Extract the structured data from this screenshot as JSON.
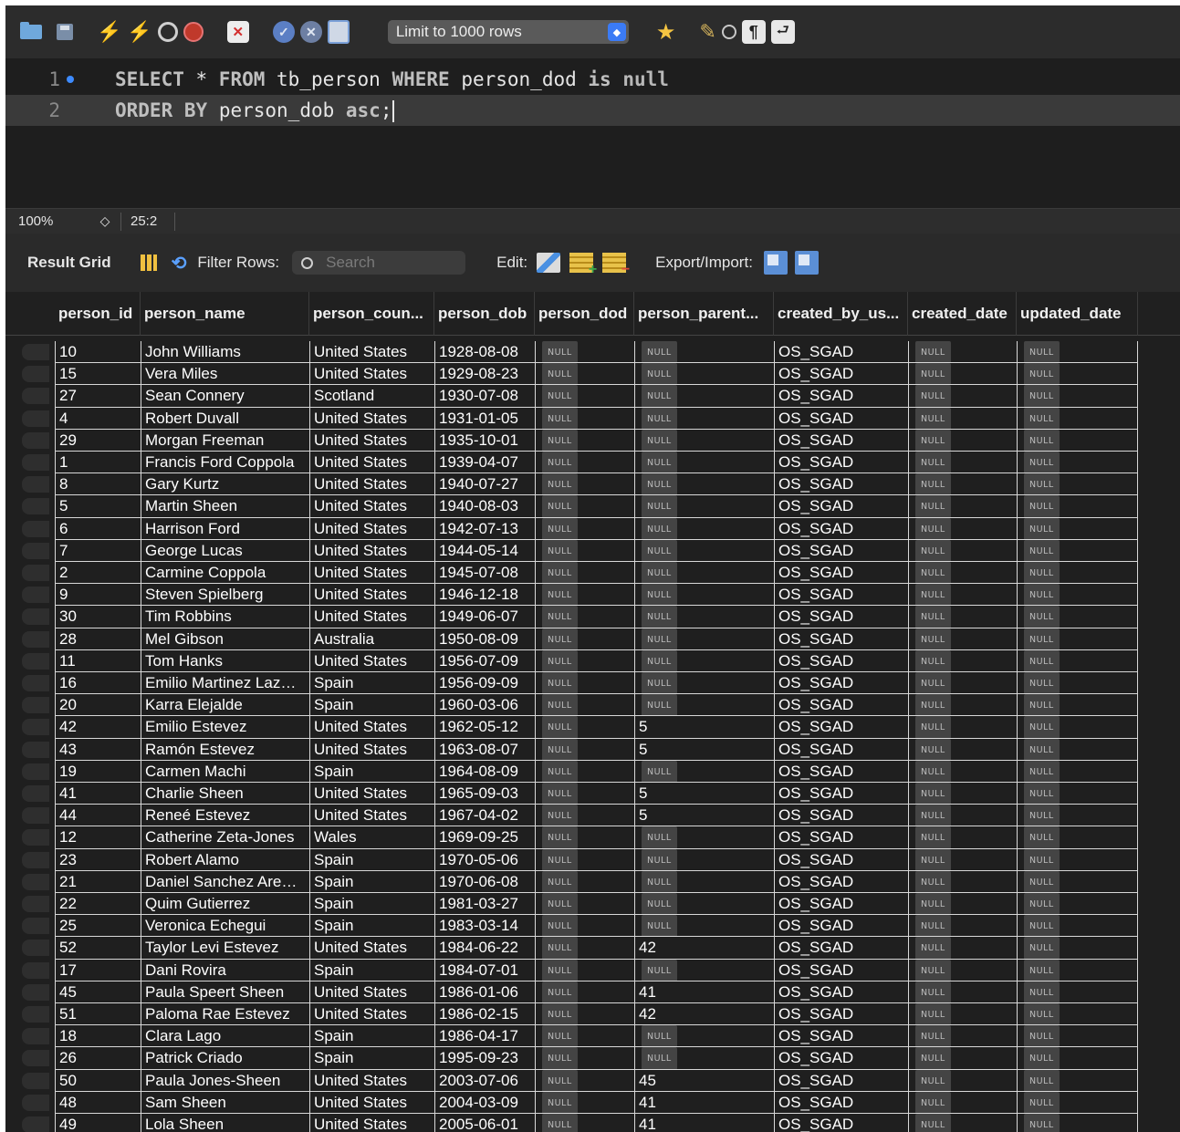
{
  "toolbar": {
    "limit_select_value": "Limit to 1000 rows",
    "icons": [
      "folder-icon",
      "save-icon",
      "execute-icon",
      "execute-current-icon",
      "explain-icon",
      "stop-icon",
      "toggle-error-icon",
      "commit-icon",
      "rollback-icon",
      "autocommit-icon",
      "add-snippet-icon",
      "beautify-icon",
      "find-icon",
      "invisible-chars-icon",
      "wrap-lines-icon"
    ]
  },
  "editor": {
    "lines": [
      {
        "number": "1",
        "tokens": [
          {
            "t": "SELECT",
            "k": "kw"
          },
          {
            "t": " * ",
            "k": "id"
          },
          {
            "t": "FROM",
            "k": "kw"
          },
          {
            "t": " tb_person ",
            "k": "id"
          },
          {
            "t": "WHERE",
            "k": "kw"
          },
          {
            "t": " person_dod ",
            "k": "id"
          },
          {
            "t": "is",
            "k": "kw"
          },
          {
            "t": " ",
            "k": "id"
          },
          {
            "t": "null",
            "k": "kwv"
          }
        ]
      },
      {
        "number": "2",
        "tokens": [
          {
            "t": "ORDER",
            "k": "kw"
          },
          {
            "t": " ",
            "k": "id"
          },
          {
            "t": "BY",
            "k": "kw"
          },
          {
            "t": " person_dob ",
            "k": "id"
          },
          {
            "t": "asc",
            "k": "kw"
          },
          {
            "t": ";",
            "k": "id"
          }
        ]
      }
    ]
  },
  "status": {
    "zoom": "100%",
    "zoom_stepper": "◇",
    "cursor_position": "25:2"
  },
  "result_toolbar": {
    "label": "Result Grid",
    "filter_label": "Filter Rows:",
    "search_placeholder": "Search",
    "edit_label": "Edit:",
    "export_label": "Export/Import:"
  },
  "grid": {
    "null_text": "NULL",
    "columns": [
      "person_id",
      "person_name",
      "person_coun...",
      "person_dob",
      "person_dod",
      "person_parent...",
      "created_by_us...",
      "created_date",
      "updated_date"
    ],
    "rows": [
      [
        "10",
        "John Williams",
        "United States",
        "1928-08-08",
        null,
        null,
        "OS_SGAD",
        null,
        null
      ],
      [
        "15",
        "Vera Miles",
        "United States",
        "1929-08-23",
        null,
        null,
        "OS_SGAD",
        null,
        null
      ],
      [
        "27",
        "Sean Connery",
        "Scotland",
        "1930-07-08",
        null,
        null,
        "OS_SGAD",
        null,
        null
      ],
      [
        "4",
        "Robert Duvall",
        "United States",
        "1931-01-05",
        null,
        null,
        "OS_SGAD",
        null,
        null
      ],
      [
        "29",
        "Morgan Freeman",
        "United States",
        "1935-10-01",
        null,
        null,
        "OS_SGAD",
        null,
        null
      ],
      [
        "1",
        "Francis Ford Coppola",
        "United States",
        "1939-04-07",
        null,
        null,
        "OS_SGAD",
        null,
        null
      ],
      [
        "8",
        "Gary Kurtz",
        "United States",
        "1940-07-27",
        null,
        null,
        "OS_SGAD",
        null,
        null
      ],
      [
        "5",
        "Martin Sheen",
        "United States",
        "1940-08-03",
        null,
        null,
        "OS_SGAD",
        null,
        null
      ],
      [
        "6",
        "Harrison Ford",
        "United States",
        "1942-07-13",
        null,
        null,
        "OS_SGAD",
        null,
        null
      ],
      [
        "7",
        "George Lucas",
        "United States",
        "1944-05-14",
        null,
        null,
        "OS_SGAD",
        null,
        null
      ],
      [
        "2",
        "Carmine Coppola",
        "United States",
        "1945-07-08",
        null,
        null,
        "OS_SGAD",
        null,
        null
      ],
      [
        "9",
        "Steven Spielberg",
        "United States",
        "1946-12-18",
        null,
        null,
        "OS_SGAD",
        null,
        null
      ],
      [
        "30",
        "Tim Robbins",
        "United States",
        "1949-06-07",
        null,
        null,
        "OS_SGAD",
        null,
        null
      ],
      [
        "28",
        "Mel Gibson",
        "Australia",
        "1950-08-09",
        null,
        null,
        "OS_SGAD",
        null,
        null
      ],
      [
        "11",
        "Tom Hanks",
        "United States",
        "1956-07-09",
        null,
        null,
        "OS_SGAD",
        null,
        null
      ],
      [
        "16",
        "Emilio Martinez Laz…",
        "Spain",
        "1956-09-09",
        null,
        null,
        "OS_SGAD",
        null,
        null
      ],
      [
        "20",
        "Karra Elejalde",
        "Spain",
        "1960-03-06",
        null,
        null,
        "OS_SGAD",
        null,
        null
      ],
      [
        "42",
        "Emilio Estevez",
        "United States",
        "1962-05-12",
        null,
        "5",
        "OS_SGAD",
        null,
        null
      ],
      [
        "43",
        "Ramón Estevez",
        "United States",
        "1963-08-07",
        null,
        "5",
        "OS_SGAD",
        null,
        null
      ],
      [
        "19",
        "Carmen Machi",
        "Spain",
        "1964-08-09",
        null,
        null,
        "OS_SGAD",
        null,
        null
      ],
      [
        "41",
        "Charlie Sheen",
        "United States",
        "1965-09-03",
        null,
        "5",
        "OS_SGAD",
        null,
        null
      ],
      [
        "44",
        "Reneé Estevez",
        "United States",
        "1967-04-02",
        null,
        "5",
        "OS_SGAD",
        null,
        null
      ],
      [
        "12",
        "Catherine Zeta-Jones",
        "Wales",
        "1969-09-25",
        null,
        null,
        "OS_SGAD",
        null,
        null
      ],
      [
        "23",
        "Robert Alamo",
        "Spain",
        "1970-05-06",
        null,
        null,
        "OS_SGAD",
        null,
        null
      ],
      [
        "21",
        "Daniel Sanchez Are…",
        "Spain",
        "1970-06-08",
        null,
        null,
        "OS_SGAD",
        null,
        null
      ],
      [
        "22",
        "Quim Gutierrez",
        "Spain",
        "1981-03-27",
        null,
        null,
        "OS_SGAD",
        null,
        null
      ],
      [
        "25",
        "Veronica Echegui",
        "Spain",
        "1983-03-14",
        null,
        null,
        "OS_SGAD",
        null,
        null
      ],
      [
        "52",
        "Taylor Levi Estevez",
        "United States",
        "1984-06-22",
        null,
        "42",
        "OS_SGAD",
        null,
        null
      ],
      [
        "17",
        "Dani Rovira",
        "Spain",
        "1984-07-01",
        null,
        null,
        "OS_SGAD",
        null,
        null
      ],
      [
        "45",
        "Paula Speert Sheen",
        "United States",
        "1986-01-06",
        null,
        "41",
        "OS_SGAD",
        null,
        null
      ],
      [
        "51",
        "Paloma Rae Estevez",
        "United States",
        "1986-02-15",
        null,
        "42",
        "OS_SGAD",
        null,
        null
      ],
      [
        "18",
        "Clara Lago",
        "Spain",
        "1986-04-17",
        null,
        null,
        "OS_SGAD",
        null,
        null
      ],
      [
        "26",
        "Patrick Criado",
        "Spain",
        "1995-09-23",
        null,
        null,
        "OS_SGAD",
        null,
        null
      ],
      [
        "50",
        "Paula Jones-Sheen",
        "United States",
        "2003-07-06",
        null,
        "45",
        "OS_SGAD",
        null,
        null
      ],
      [
        "48",
        "Sam Sheen",
        "United States",
        "2004-03-09",
        null,
        "41",
        "OS_SGAD",
        null,
        null
      ],
      [
        "49",
        "Lola Sheen",
        "United States",
        "2005-06-01",
        null,
        "41",
        "OS_SGAD",
        null,
        null
      ]
    ]
  }
}
